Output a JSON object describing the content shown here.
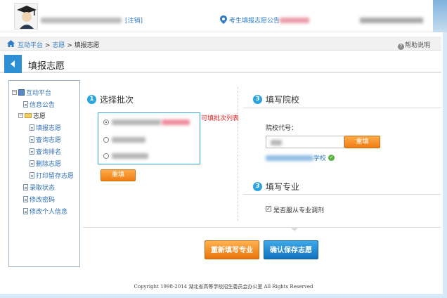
{
  "header": {
    "logout_label": "[注销]",
    "announcement_label": "考生填报志愿公告",
    "pin_icon": "location-pin-icon"
  },
  "breadcrumb": {
    "items": [
      "互动平台",
      "志愿",
      "填报志愿"
    ],
    "separator": ">",
    "help_label": "帮助说明"
  },
  "page": {
    "title": "填报志愿"
  },
  "tree": {
    "root": "互动平台",
    "items": [
      {
        "label": "信息公告",
        "level": 1
      },
      {
        "label": "志愿",
        "level": 1,
        "expanded": true
      },
      {
        "label": "填报志愿",
        "level": 2
      },
      {
        "label": "查询志愿",
        "level": 2
      },
      {
        "label": "查询排名",
        "level": 2
      },
      {
        "label": "删除志愿",
        "level": 2
      },
      {
        "label": "打印留存志愿",
        "level": 2
      },
      {
        "label": "录取状态",
        "level": 1
      },
      {
        "label": "修改密码",
        "level": 1
      },
      {
        "label": "修改个人信息",
        "level": 1
      }
    ]
  },
  "section1": {
    "number": "1",
    "title": "选择批次",
    "hint": "可填批次列表",
    "reset_label": "重填"
  },
  "section3a": {
    "number": "3",
    "title": "填写院校",
    "code_label": "院校代号：",
    "reset_label": "重填",
    "result_suffix": "学校"
  },
  "section3b": {
    "number": "3",
    "title": "填写专业",
    "checkbox_label": "是否服从专业调剂",
    "checkbox_checked": true
  },
  "actions": {
    "rewrite_label": "重新填写专业",
    "confirm_label": "确认保存志愿"
  },
  "footer": {
    "text": "Copyright 1998-2014 湖北省高等学校招生委员会办公室 All Rights Reserved"
  },
  "colors": {
    "accent_blue": "#2d8fd4",
    "orange": "#ee7d12",
    "hint_red": "#e02020"
  }
}
